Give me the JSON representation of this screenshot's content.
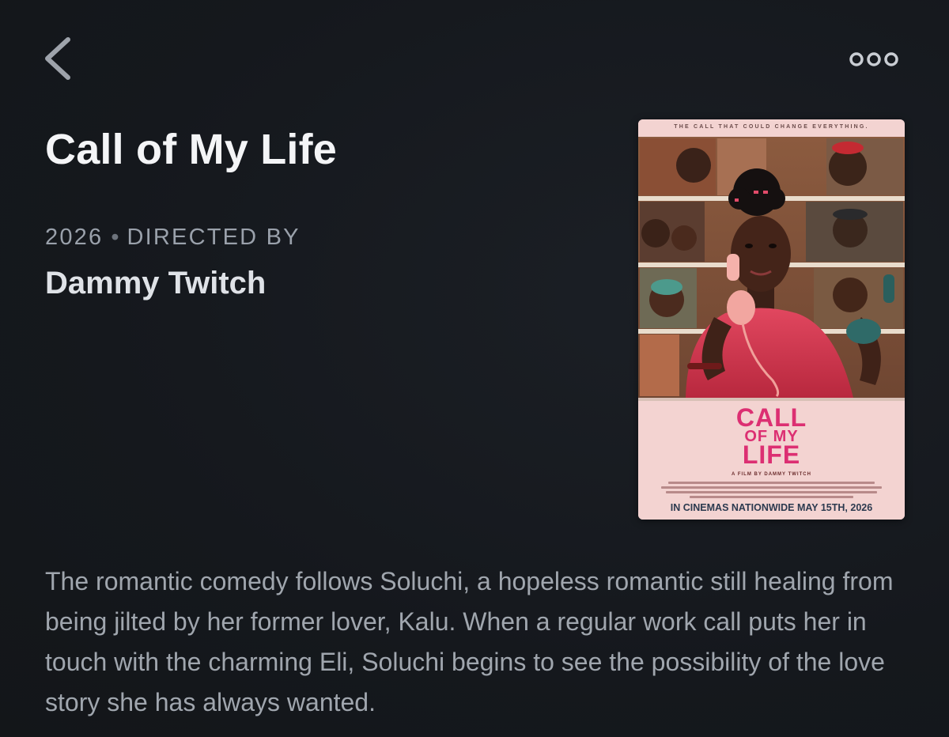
{
  "nav": {
    "back_icon": "chevron-left-icon",
    "more_icon": "more-horizontal-icon"
  },
  "movie": {
    "title": "Call of My Life",
    "year": "2026",
    "separator": "•",
    "directed_by_label": "DIRECTED BY",
    "director": "Dammy Twitch",
    "description": "The romantic comedy follows Soluchi, a hopeless romantic still healing from being jilted by her former lover, Kalu. When a regular work call puts her in touch with the charming Eli, Soluchi begins to see the possibility of the love story she has always wanted."
  },
  "poster": {
    "tagline": "THE CALL THAT COULD CHANGE EVERYTHING.",
    "title_line1": "CALL",
    "title_line2": "OF MY",
    "title_line3": "LIFE",
    "credit": "A FILM BY DAMMY TWITCH",
    "release": "IN CINEMAS NATIONWIDE MAY 15TH, 2026"
  },
  "colors": {
    "background": "#15181d",
    "title": "#f4f5f7",
    "meta": "#9aa1ab",
    "body_text": "#a0a6ae",
    "icon": "#9ea3ab",
    "poster_title": "#dc2f72"
  }
}
